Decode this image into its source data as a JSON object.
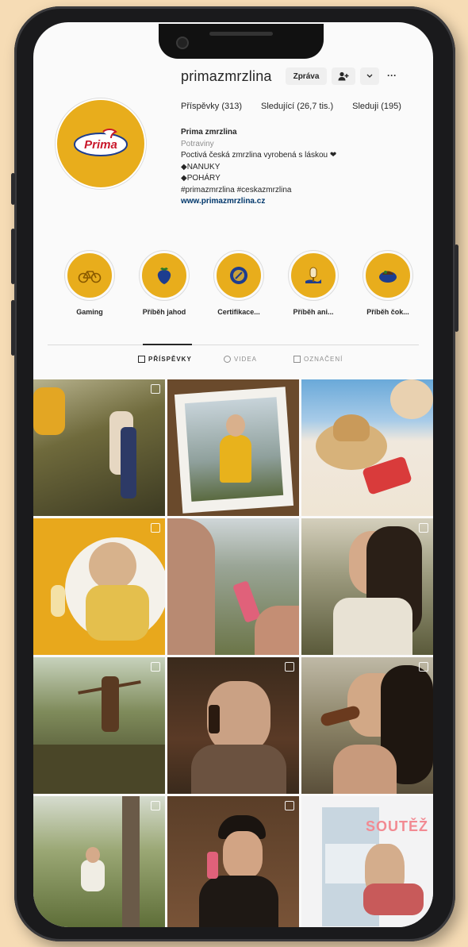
{
  "profile": {
    "username": "primazmrzlina",
    "follow_button": "Zpráva",
    "more_button": "···",
    "stats": {
      "posts": "Příspěvky (313)",
      "followers": "Sledující (26,7 tis.)",
      "following": "Sleduji (195)"
    },
    "bio": {
      "name": "Prima zmrzlina",
      "category": "Potraviny",
      "line1": "Poctivá česká zmrzlina vyrobená s láskou",
      "line2": "◆NANUKY",
      "line3": "◆POHÁRY",
      "hashtags": "#primazmrzlina #ceskazmrzlina",
      "website": "www.primazmrzlina.cz"
    },
    "logo_text": "Prima"
  },
  "highlights": [
    {
      "label": "Gaming",
      "icon": "bicycle-icon"
    },
    {
      "label": "Příběh jahod",
      "icon": "strawberry-icon"
    },
    {
      "label": "Certifikace...",
      "icon": "medal-icon"
    },
    {
      "label": "Příběh ani...",
      "icon": "ice-cream-icon"
    },
    {
      "label": "Příběh čok...",
      "icon": "chocolate-icon"
    }
  ],
  "tabs": [
    {
      "label": "PŘÍSPĚVKY",
      "active": true
    },
    {
      "label": "VIDEA",
      "active": false
    },
    {
      "label": "OZNAČENÍ",
      "active": false
    }
  ],
  "posts_overlay_text": "SOUTĚŽ",
  "colors": {
    "brand_yellow": "#e8ad1c",
    "background": "#f6dcb5",
    "phone_frame": "#1a1a1c"
  }
}
